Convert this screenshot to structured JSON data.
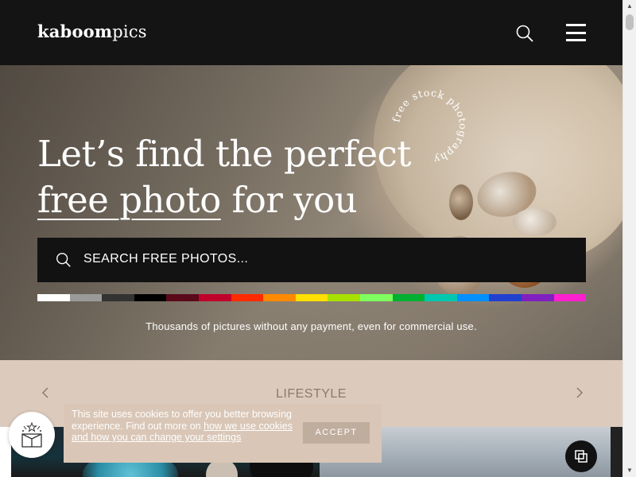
{
  "header": {
    "logo_bold": "kaboom",
    "logo_light": "pics",
    "search_icon": "search-icon",
    "menu_icon": "hamburger-menu-icon"
  },
  "hero": {
    "title_line1": "Let’s find the perfect",
    "title_link": "free photo",
    "title_line2_rest": " for you",
    "badge_text": "free stock photography",
    "search_placeholder": "SEARCH FREE PHOTOS...",
    "tagline": "Thousands of pictures without any payment, even for commercial use.",
    "color_filters": [
      "#ffffff",
      "#9a9a9a",
      "#333333",
      "#000000",
      "#5a0a1a",
      "#c0002a",
      "#ff2a00",
      "#ff8a00",
      "#ffe000",
      "#a8e000",
      "#7fff5f",
      "#00b030",
      "#00c8b0",
      "#0090ff",
      "#2040d0",
      "#8020c0",
      "#ff20d0"
    ]
  },
  "category": {
    "label": "LIFESTYLE",
    "prev_icon": "chevron-left-icon",
    "next_icon": "chevron-right-icon"
  },
  "cookie": {
    "text_before": "This site uses cookies to offer you better browsing experience. Find out more on ",
    "link_text": "how we use cookies and how you can change your settings",
    "accept_label": "ACCEPT"
  },
  "floating": {
    "gift_icon": "gift-box-icon",
    "gallery_icon": "gallery-stack-icon"
  }
}
